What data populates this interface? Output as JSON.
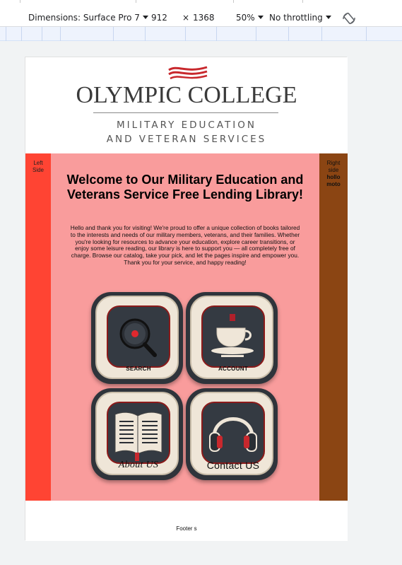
{
  "devtools": {
    "dimensions_label": "Dimensions: Surface Pro 7",
    "width": "912",
    "times": "×",
    "height": "1368",
    "zoom": "50%",
    "throttling": "No throttling",
    "rotate_icon": "rotate-icon"
  },
  "header": {
    "logo_name": "OLYMPIC COLLEGE",
    "logo_sub1": "MILITARY EDUCATION",
    "logo_sub2": "AND VETERAN SERVICES"
  },
  "left_side": "Left Side",
  "right_side": {
    "text": "Right side",
    "bold": "hollo moto"
  },
  "main": {
    "title": "Welcome to Our Military Education and Veterans Service Free Lending Library!",
    "intro": "Hello and thank you for visiting! We're proud to offer a unique collection of books tailored to the interests and needs of our military members, veterans, and their families. Whether you're looking for resources to advance your education, explore career transitions, or enjoy some leisure reading, our library is here to support you — all completely free of charge. Browse our catalog, take your pick, and let the pages inspire and empower you. Thank you for your service, and happy reading!",
    "tiles": [
      {
        "label": "SEARCH",
        "icon": "search-icon"
      },
      {
        "label": "ACCOUNT",
        "icon": "coffee-cup-icon"
      },
      {
        "label": "About US",
        "icon": "book-icon"
      },
      {
        "label": "Contact US",
        "icon": "headphones-icon"
      }
    ]
  },
  "footer": "Footer s",
  "colors": {
    "left_side": "#ff4433",
    "main_bg": "#f99c9c",
    "right_side": "#8b4513",
    "tile_dark": "#2f343b",
    "accent_red": "#8b1a1a"
  }
}
